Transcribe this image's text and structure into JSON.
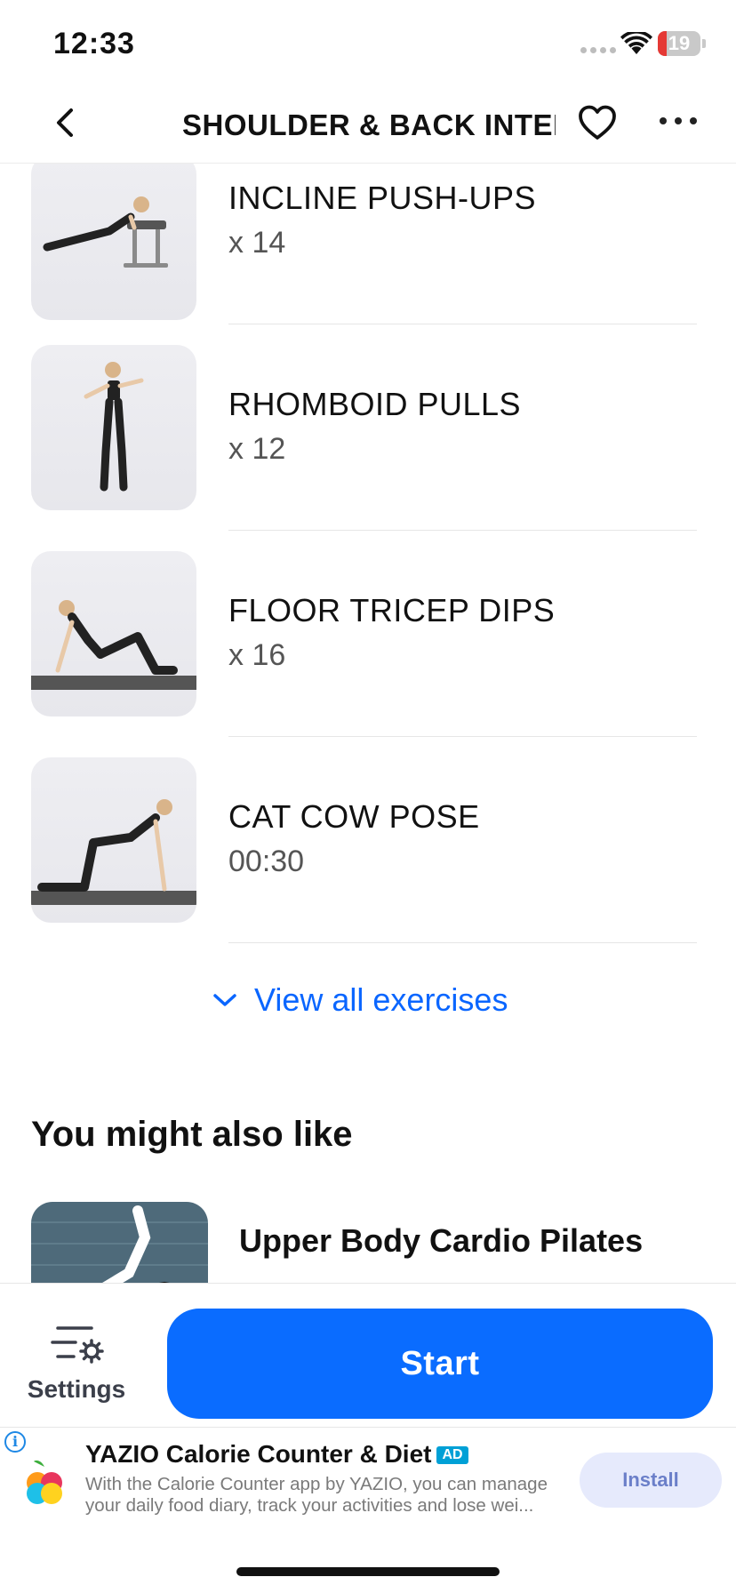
{
  "status_bar": {
    "time": "12:33",
    "battery_level": "19"
  },
  "nav": {
    "title": "SHOULDER & BACK INTER...",
    "back_icon": "chevron-left-icon",
    "favorite_icon": "heart-icon",
    "more_icon": "ellipsis-icon"
  },
  "exercises": [
    {
      "name": "INCLINE PUSH-UPS",
      "reps": "x 14"
    },
    {
      "name": "RHOMBOID PULLS",
      "reps": "x 12"
    },
    {
      "name": "FLOOR TRICEP DIPS",
      "reps": "x 16"
    },
    {
      "name": "CAT COW POSE",
      "reps": "00:30"
    }
  ],
  "view_all_label": "View all exercises",
  "section_title": "You might also like",
  "recommendation": {
    "title": "Upper Body Cardio Pilates"
  },
  "action_bar": {
    "settings_label": "Settings",
    "start_label": "Start"
  },
  "ad": {
    "title": "YAZIO Calorie Counter & Diet",
    "badge": "AD",
    "description": "With the Calorie Counter app by YAZIO, you can manage your daily food diary, track your activities and lose wei...",
    "install_label": "Install"
  },
  "colors": {
    "accent": "#0a6cff",
    "link": "#0a66ff",
    "ad_badge": "#00a0d6"
  }
}
